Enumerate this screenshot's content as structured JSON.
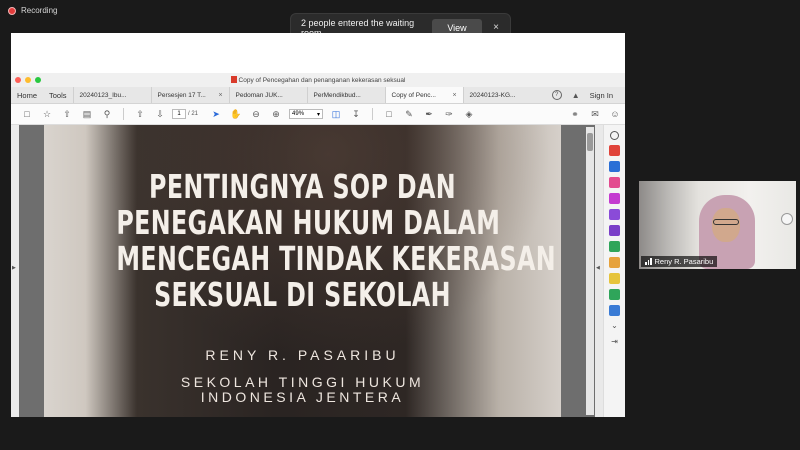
{
  "recording": {
    "label": "Recording"
  },
  "notification": {
    "text": "2 people entered the waiting room",
    "view_label": "View",
    "close_glyph": "×"
  },
  "pdf_window": {
    "title": "Copy of Pencegahan dan penanganan kekerasan seksual",
    "nav": [
      "Home",
      "Tools"
    ],
    "tabs": [
      {
        "label": "20240123_Ibu...",
        "closable": false,
        "active": false
      },
      {
        "label": "Persesjen 17 T...",
        "closable": true,
        "active": false
      },
      {
        "label": "Pedoman JUK...",
        "closable": false,
        "active": false
      },
      {
        "label": "PerMendikbud...",
        "closable": false,
        "active": false
      },
      {
        "label": "Copy of Penc...",
        "closable": true,
        "active": true
      },
      {
        "label": "20240123-KG...",
        "closable": false,
        "active": false
      }
    ],
    "signin_label": "Sign In",
    "help_glyph": "?",
    "page_current": "1",
    "page_total": "/ 21",
    "zoom_value": "49%"
  },
  "slide": {
    "title_lines": [
      "PENTINGNYA SOP DAN",
      "PENEGAKAN HUKUM DALAM",
      "MENCEGAH TINDAK KEKERASAN",
      "SEKSUAL DI SEKOLAH"
    ],
    "author": "RENY R. PASARIBU",
    "institution_lines": [
      "SEKOLAH TINGGI HUKUM",
      "INDONESIA JENTERA"
    ]
  },
  "participant": {
    "name": "Reny R. Pasaribu"
  },
  "colors": {
    "background": "#1a1a1a",
    "record_red": "#e23b3b",
    "acrobat_red": "#d93b2b",
    "tool_blue": "#2a6ad9"
  }
}
